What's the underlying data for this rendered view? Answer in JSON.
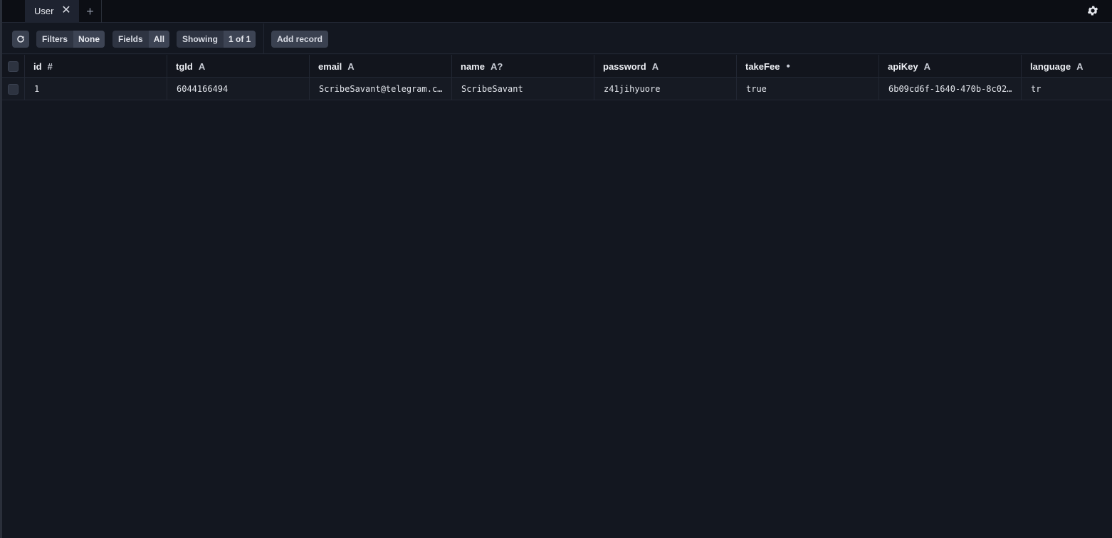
{
  "tabs": [
    {
      "label": "User"
    }
  ],
  "toolbar": {
    "filters": {
      "label": "Filters",
      "value": "None"
    },
    "fields": {
      "label": "Fields",
      "value": "All"
    },
    "showing": {
      "label": "Showing",
      "value": "1 of 1"
    },
    "add_record": "Add record"
  },
  "columns": [
    {
      "name": "id",
      "type": "#"
    },
    {
      "name": "tgId",
      "type": "A"
    },
    {
      "name": "email",
      "type": "A"
    },
    {
      "name": "name",
      "type": "A?"
    },
    {
      "name": "password",
      "type": "A"
    },
    {
      "name": "takeFee",
      "type": "⚫"
    },
    {
      "name": "apiKey",
      "type": "A"
    },
    {
      "name": "language",
      "type": "A"
    }
  ],
  "rows": [
    [
      "1",
      "6044166494",
      "ScribeSavant@telegram.c…",
      "ScribeSavant",
      "z41jihyuore",
      "true",
      "6b09cd6f-1640-470b-8c02…",
      "tr"
    ]
  ]
}
